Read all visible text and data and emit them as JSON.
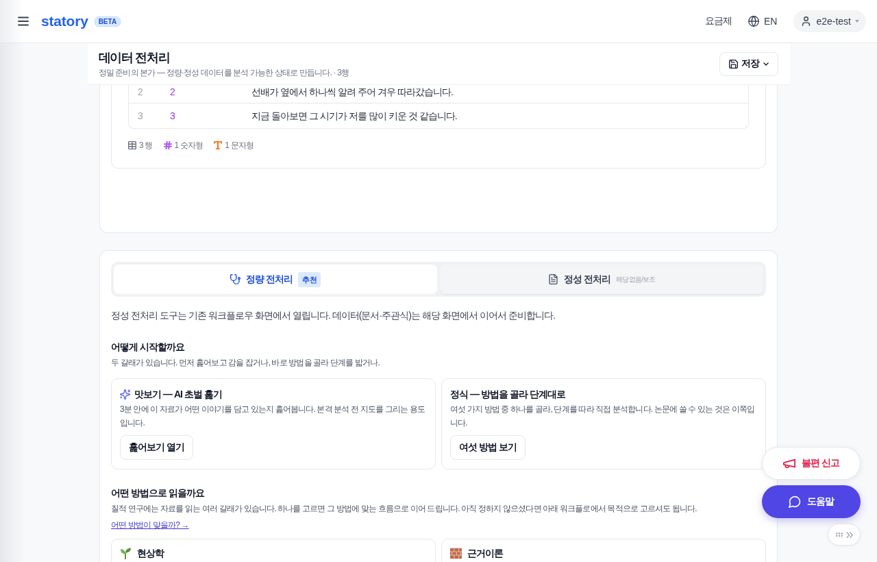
{
  "header": {
    "logo": "statory",
    "badge": "BETA",
    "pricing_link": "요금제",
    "language": "EN",
    "user": "e2e-test"
  },
  "page_header": {
    "title": "데이터 전처리",
    "subtitle": "정밀 준비의 본가 — 정량·정성 데이터를 분석 가능한 상태로 만듭니다. · 3행",
    "save_button": "저장"
  },
  "data_preview": {
    "rows": [
      {
        "cells": [
          "2",
          "2",
          "선배가 옆에서 하나씩 알려 주어 겨우 따라갔습니다."
        ]
      },
      {
        "cells": [
          "3",
          "3",
          "지금 돌아보면 그 시기가 저를 많이 키운 것 같습니다."
        ]
      }
    ],
    "summary": [
      {
        "text": "3 행",
        "color": "#6b7280"
      },
      {
        "text": "1 숫자형",
        "color": "#a855f7"
      },
      {
        "text": "1 문자형",
        "color": "#f97316"
      }
    ]
  },
  "tabs": [
    {
      "label": "정량 전처리",
      "badge": "추천",
      "selected": true
    },
    {
      "label": "정성 전처리",
      "note": "해당 없음/보조",
      "selected": false
    }
  ],
  "notice": "정성 전처리 도구는 기존 워크플로우 화면에서 열립니다. 데이터(문서·주관식)는 해당 화면에서 이어서 준비합니다.",
  "start_section": {
    "heading": "어떻게 시작할까요",
    "description": "두 갈래가 있습니다. 먼저 훑어보고 감을 잡거나, 바로 방법을 골라 단계를 밟거나.",
    "options": [
      {
        "kind": "ai",
        "title": "맛보기 — AI 초벌 훑기",
        "description": "3분 안에 이 자료가 어떤 이야기를 담고 있는지 훑어봅니다. 본격 분석 전 지도를 그리는 용도입니다.",
        "button": "훑어보기 열기"
      },
      {
        "kind": "manual",
        "title": "정식 — 방법을 골라 단계대로",
        "description": "여섯 가지 방법 중 하나를 골라, 단계를 따라 직접 분석합니다. 논문에 쓸 수 있는 것은 이쪽입니다.",
        "button": "여섯 방법 보기"
      }
    ]
  },
  "methods_section": {
    "heading": "어떤 방법으로 읽을까요",
    "description": "질적 연구에는 자료를 읽는 여러 갈래가 있습니다. 하나를 고르면 그 방법에 맞는 흐름으로 이어 드립니다. 아직 정하지 않으셨다면 아래 워크플로에서 목적으로 고르셔도 됩니다.",
    "link": "어떤 방법이 맞을까? →",
    "methods": [
      {
        "name": "현상학"
      },
      {
        "name": "근거이론"
      }
    ]
  },
  "floating": {
    "feedback_button": "불편 신고",
    "help_button": "도움말"
  }
}
